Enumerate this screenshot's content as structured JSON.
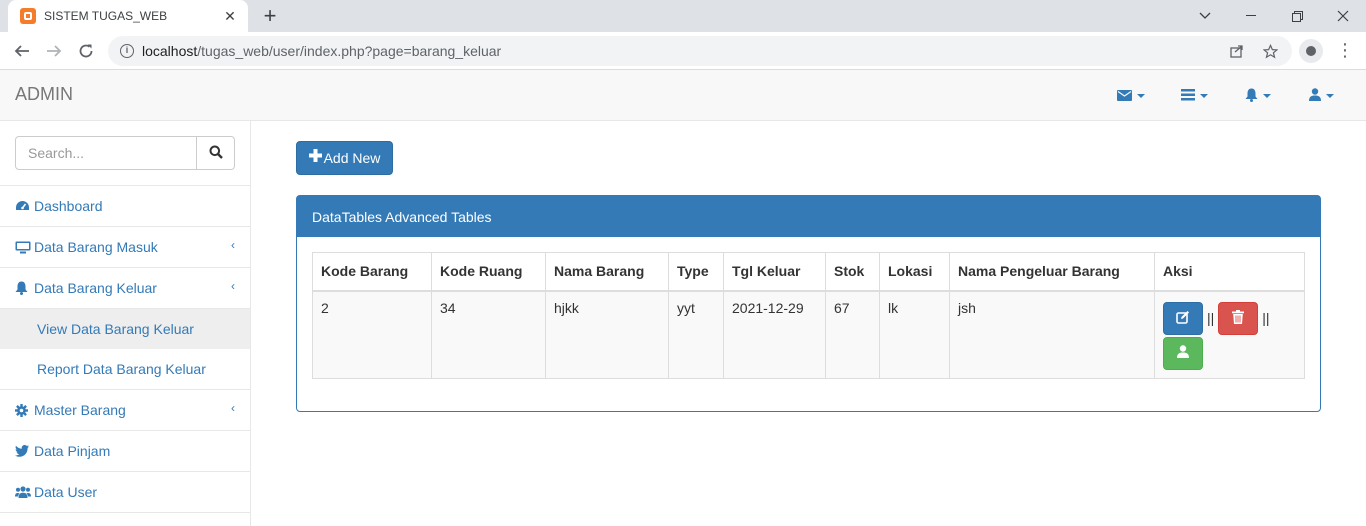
{
  "browser": {
    "tab_title": "SISTEM TUGAS_WEB",
    "url_host": "localhost",
    "url_path": "/tugas_web/user/index.php?page=barang_keluar"
  },
  "navbar": {
    "brand": "ADMIN",
    "dropdowns": [
      "envelope-icon",
      "tasks-icon",
      "bell-icon",
      "user-icon"
    ]
  },
  "sidebar": {
    "search_placeholder": "Search...",
    "items": [
      {
        "label": "Dashboard",
        "icon": "dashboard-icon"
      },
      {
        "label": "Data Barang Masuk",
        "icon": "desktop-icon",
        "has_arrow": true
      },
      {
        "label": "Data Barang Keluar",
        "icon": "bell-icon",
        "has_arrow": true,
        "children": [
          "View Data Barang Keluar",
          "Report Data Barang Keluar"
        ]
      },
      {
        "label": "Master Barang",
        "icon": "gear-icon",
        "has_arrow": true
      },
      {
        "label": "Data Pinjam",
        "icon": "twitter-icon"
      },
      {
        "label": "Data User",
        "icon": "users-icon"
      }
    ]
  },
  "main": {
    "add_button": "Add New",
    "panel_title": "DataTables Advanced Tables",
    "table": {
      "columns": [
        "Kode Barang",
        "Kode Ruang",
        "Nama Barang",
        "Type",
        "Tgl Keluar",
        "Stok",
        "Lokasi",
        "Nama Pengeluar Barang",
        "Aksi"
      ],
      "rows": [
        [
          "2",
          "34",
          "hjkk",
          "yyt",
          "2021-12-29",
          "67",
          "lk",
          "jsh"
        ]
      ],
      "action_separator": "||"
    }
  },
  "colors": {
    "primary": "#337ab7",
    "danger": "#d9534f",
    "success": "#5cb85c"
  }
}
